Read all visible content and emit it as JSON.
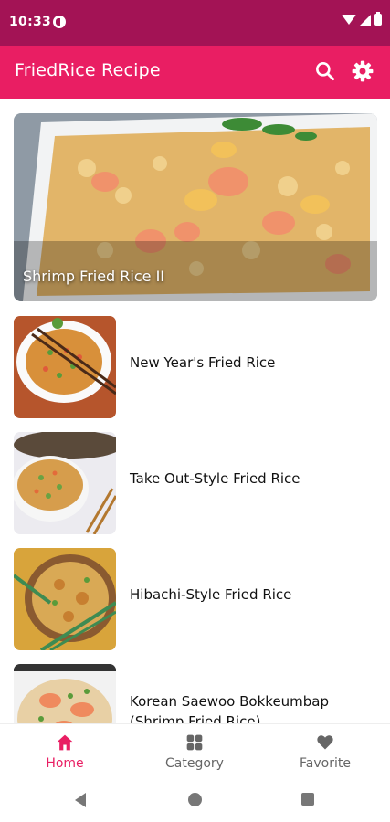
{
  "status_bar": {
    "time": "10:33"
  },
  "app_bar": {
    "title": "FriedRice Recipe",
    "search_icon": "search-icon",
    "settings_icon": "gear-icon"
  },
  "featured": {
    "title": "Shrimp Fried Rice II"
  },
  "recipes": [
    {
      "title": "New Year's Fried Rice"
    },
    {
      "title": "Take Out-Style Fried Rice"
    },
    {
      "title": "Hibachi-Style Fried Rice"
    },
    {
      "title": "Korean Saewoo Bokkeumbap (Shrimp Fried Rice)"
    }
  ],
  "bottom_nav": [
    {
      "label": "Home",
      "icon": "home-icon",
      "active": true
    },
    {
      "label": "Category",
      "icon": "grid-icon",
      "active": false
    },
    {
      "label": "Favorite",
      "icon": "heart-icon",
      "active": false
    }
  ],
  "colors": {
    "primary": "#e91e63",
    "status_bar": "#a31355",
    "inactive": "#666666"
  }
}
